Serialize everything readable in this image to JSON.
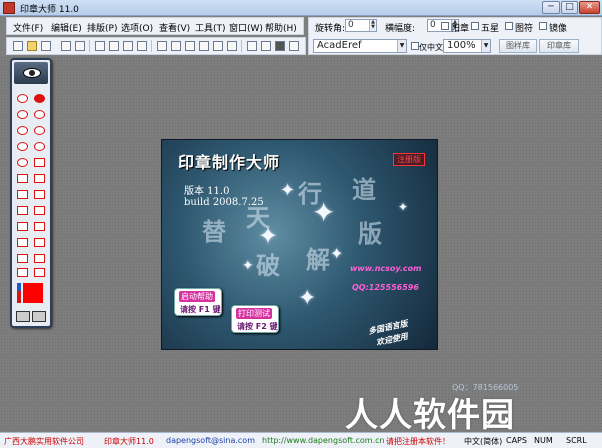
{
  "window": {
    "title": "印章大师 11.0",
    "minimize": "─",
    "maximize": "□",
    "close": "✕"
  },
  "menu": [
    "文件(F)",
    "编辑(E)",
    "排版(P)",
    "选项(O)",
    "查看(V)",
    "工具(T)",
    "窗口(W)",
    "帮助(H)"
  ],
  "props": {
    "rotation_label": "旋转角:",
    "rotation_value": "0",
    "stretch_label": "横幅度:",
    "stretch_value": "0",
    "checkboxes": [
      "阳章",
      "五星",
      "图符",
      "镜像"
    ],
    "font_value": "AcadEref",
    "only_chinese_label": "仅中文",
    "zoom_value": "100%",
    "tabs": [
      "图样库",
      "印章库"
    ]
  },
  "splash": {
    "title": "印章制作大师",
    "badge": "注册版",
    "version": "版本 11.0",
    "build": "build 2008.7.25",
    "calligraphy": [
      "替",
      "天",
      "行",
      "道",
      "破",
      "解",
      "版"
    ],
    "website": "www.ncsoy.com",
    "qq": "QQ:125556596",
    "btn_help_line1": "启动帮助",
    "btn_help_line2": "请按 F1 键",
    "btn_print_line1": "打印测试",
    "btn_print_line2": "请按 F2 键",
    "lang_line1": "多国语言版",
    "lang_line2": "欢迎使用"
  },
  "statusbar": {
    "company": "广西大鹏实用软件公司",
    "product": "印章大师11.0",
    "email": "dapengsoft@sina.com",
    "website": "http://www.dapengsoft.com.cn",
    "register": "请把注册本软件！",
    "ime": "中文(简体)",
    "caps": "CAPS",
    "num": "NUM",
    "scrl": "SCRL"
  },
  "overlay": {
    "qq_line": "QQ：781566005",
    "watermark": "人人软件园"
  },
  "colors": {
    "tool_red": "#dd1111",
    "splash_bg": "#2e5870",
    "accent_pink": "#ff5fd7"
  }
}
